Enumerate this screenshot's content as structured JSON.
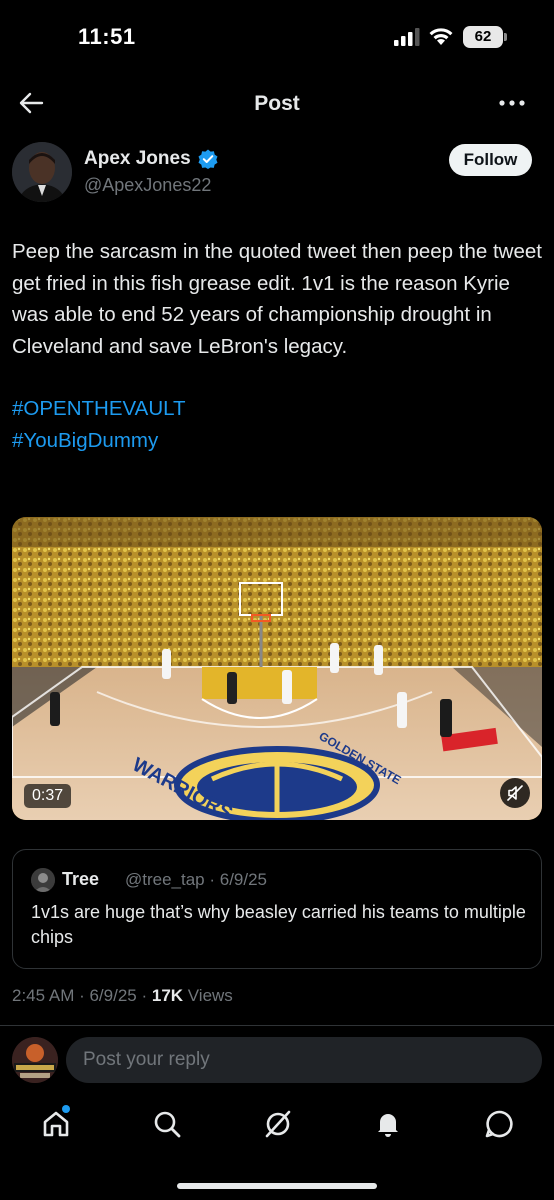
{
  "status_bar": {
    "time": "11:51",
    "battery": "62"
  },
  "header": {
    "title": "Post"
  },
  "author": {
    "name": "Apex Jones",
    "handle": "@ApexJones22",
    "follow_label": "Follow"
  },
  "post": {
    "text": "Peep the sarcasm in the quoted tweet then peep the tweet get fried in this fish grease edit. 1v1 is the reason Kyrie was able to end 52 years of championship drought in Cleveland and save LeBron's legacy.",
    "hashtags": [
      "#OPENTHEVAULT",
      "#YouBigDummy"
    ]
  },
  "media": {
    "duration": "0:37",
    "court_logo_text": "WARRIORS",
    "court_text_2": "GOLDEN STATE"
  },
  "quote": {
    "name": "Tree",
    "meta": "@tree_tap · 6/9/25",
    "text": "1v1s are huge that’s why beasley carried his teams to multiple chips"
  },
  "timestamp": {
    "time_date": "2:45 AM · 6/9/25 · ",
    "views_count": "17K",
    "views_label": " Views"
  },
  "reply": {
    "placeholder": "Post your reply"
  },
  "colors": {
    "accent": "#1d9bf0",
    "background": "#000000",
    "secondary_text": "#71767b"
  },
  "nav": [
    "home-icon",
    "search-icon",
    "grok-icon",
    "notifications-icon",
    "messages-icon"
  ]
}
